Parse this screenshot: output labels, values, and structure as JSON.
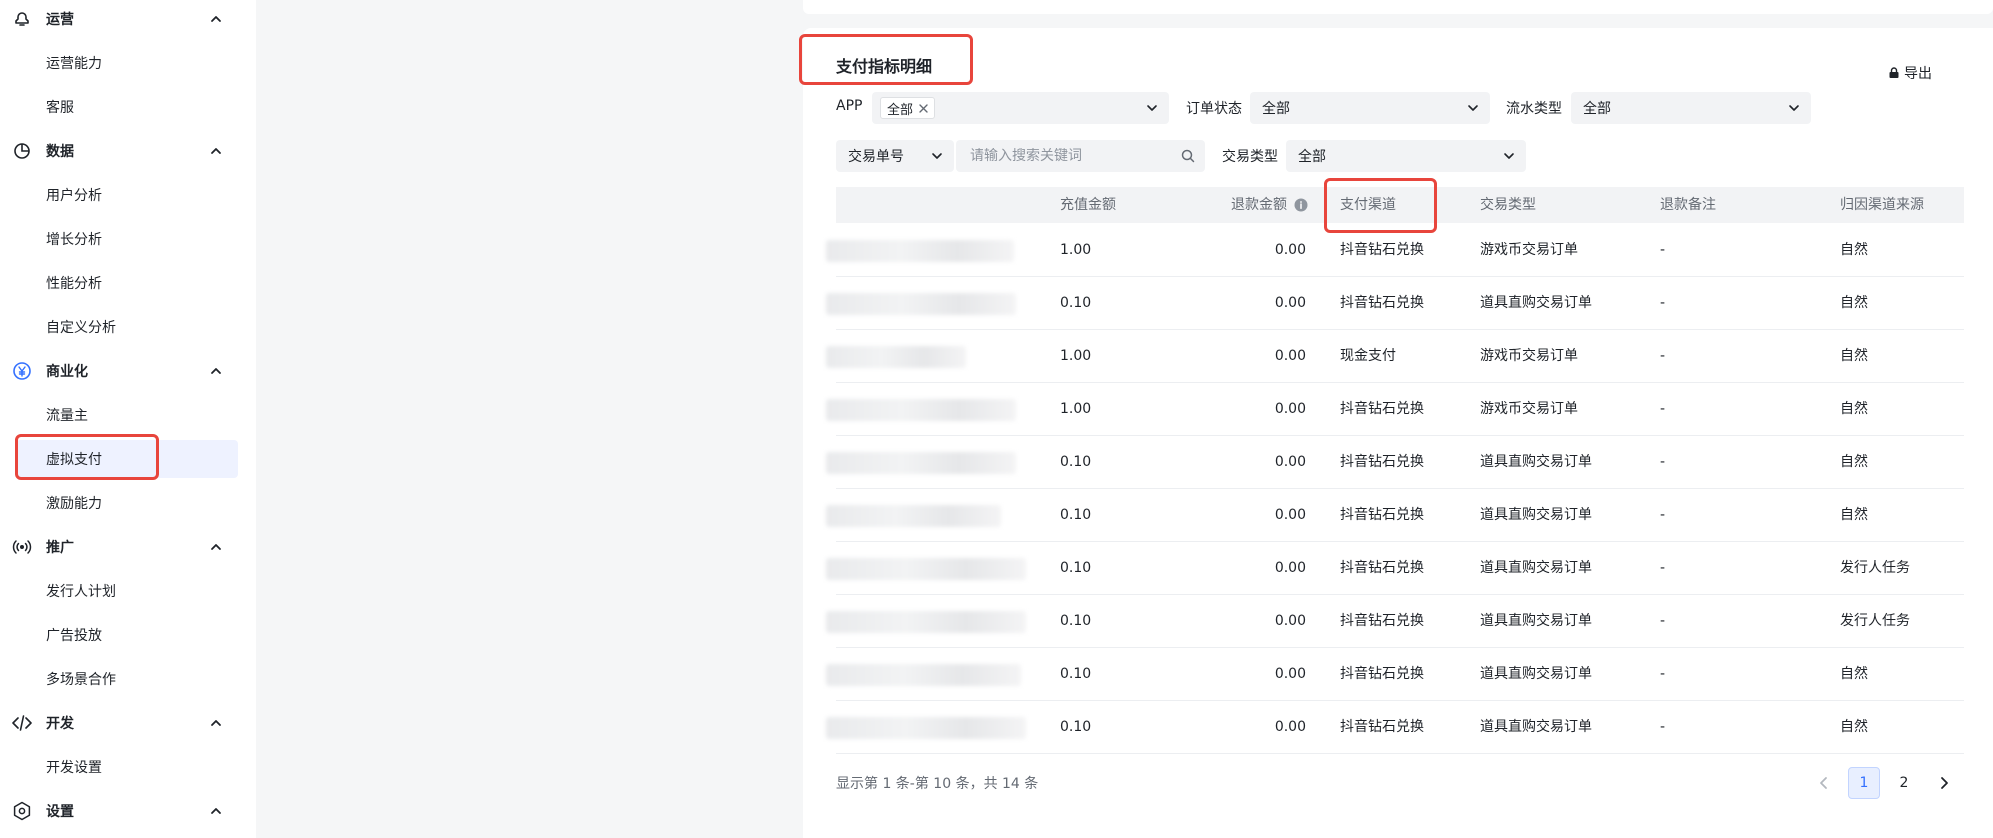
{
  "sidebar": {
    "groups": [
      {
        "label": "运营",
        "icon": "operations-icon",
        "items": [
          "运营能力",
          "客服"
        ]
      },
      {
        "label": "数据",
        "icon": "pie-chart-icon",
        "items": [
          "用户分析",
          "增长分析",
          "性能分析",
          "自定义分析"
        ]
      },
      {
        "label": "商业化",
        "icon": "yuan-coin-icon",
        "items": [
          "流量主",
          "虚拟支付",
          "激励能力"
        ]
      },
      {
        "label": "推广",
        "icon": "broadcast-icon",
        "items": [
          "发行人计划",
          "广告投放",
          "多场景合作"
        ]
      },
      {
        "label": "开发",
        "icon": "code-icon",
        "items": [
          "开发设置"
        ]
      },
      {
        "label": "设置",
        "icon": "settings-icon",
        "items": []
      }
    ],
    "active_item": "虚拟支付"
  },
  "main": {
    "title": "支付指标明细",
    "export_label": "导出",
    "filters": {
      "app_label": "APP",
      "app_tag": "全部",
      "order_status_label": "订单状态",
      "order_status_value": "全部",
      "flow_type_label": "流水类型",
      "flow_type_value": "全部",
      "search_field_value": "交易单号",
      "search_placeholder": "请输入搜索关键词",
      "trade_type_label": "交易类型",
      "trade_type_value": "全部"
    },
    "table": {
      "columns": [
        "充值金额",
        "退款金额",
        "支付渠道",
        "交易类型",
        "退款备注",
        "归因渠道来源"
      ],
      "rows": [
        {
          "recharge": "1.00",
          "refund": "0.00",
          "channel": "抖音钻石兑换",
          "trade_type": "游戏币交易订单",
          "note": "-",
          "source": "自然"
        },
        {
          "recharge": "0.10",
          "refund": "0.00",
          "channel": "抖音钻石兑换",
          "trade_type": "道具直购交易订单",
          "note": "-",
          "source": "自然"
        },
        {
          "recharge": "1.00",
          "refund": "0.00",
          "channel": "现金支付",
          "trade_type": "游戏币交易订单",
          "note": "-",
          "source": "自然"
        },
        {
          "recharge": "1.00",
          "refund": "0.00",
          "channel": "抖音钻石兑换",
          "trade_type": "游戏币交易订单",
          "note": "-",
          "source": "自然"
        },
        {
          "recharge": "0.10",
          "refund": "0.00",
          "channel": "抖音钻石兑换",
          "trade_type": "道具直购交易订单",
          "note": "-",
          "source": "自然"
        },
        {
          "recharge": "0.10",
          "refund": "0.00",
          "channel": "抖音钻石兑换",
          "trade_type": "道具直购交易订单",
          "note": "-",
          "source": "自然"
        },
        {
          "recharge": "0.10",
          "refund": "0.00",
          "channel": "抖音钻石兑换",
          "trade_type": "道具直购交易订单",
          "note": "-",
          "source": "发行人任务"
        },
        {
          "recharge": "0.10",
          "refund": "0.00",
          "channel": "抖音钻石兑换",
          "trade_type": "道具直购交易订单",
          "note": "-",
          "source": "发行人任务"
        },
        {
          "recharge": "0.10",
          "refund": "0.00",
          "channel": "抖音钻石兑换",
          "trade_type": "道具直购交易订单",
          "note": "-",
          "source": "自然"
        },
        {
          "recharge": "0.10",
          "refund": "0.00",
          "channel": "抖音钻石兑换",
          "trade_type": "道具直购交易订单",
          "note": "-",
          "source": "自然"
        }
      ]
    },
    "footer_text": "显示第 1 条-第 10 条，共 14 条",
    "pagination": {
      "pages": [
        "1",
        "2"
      ],
      "current": "1"
    }
  },
  "colors": {
    "accent": "#3370ff",
    "highlight": "#e8453c",
    "active_bg": "#eef2ff"
  }
}
